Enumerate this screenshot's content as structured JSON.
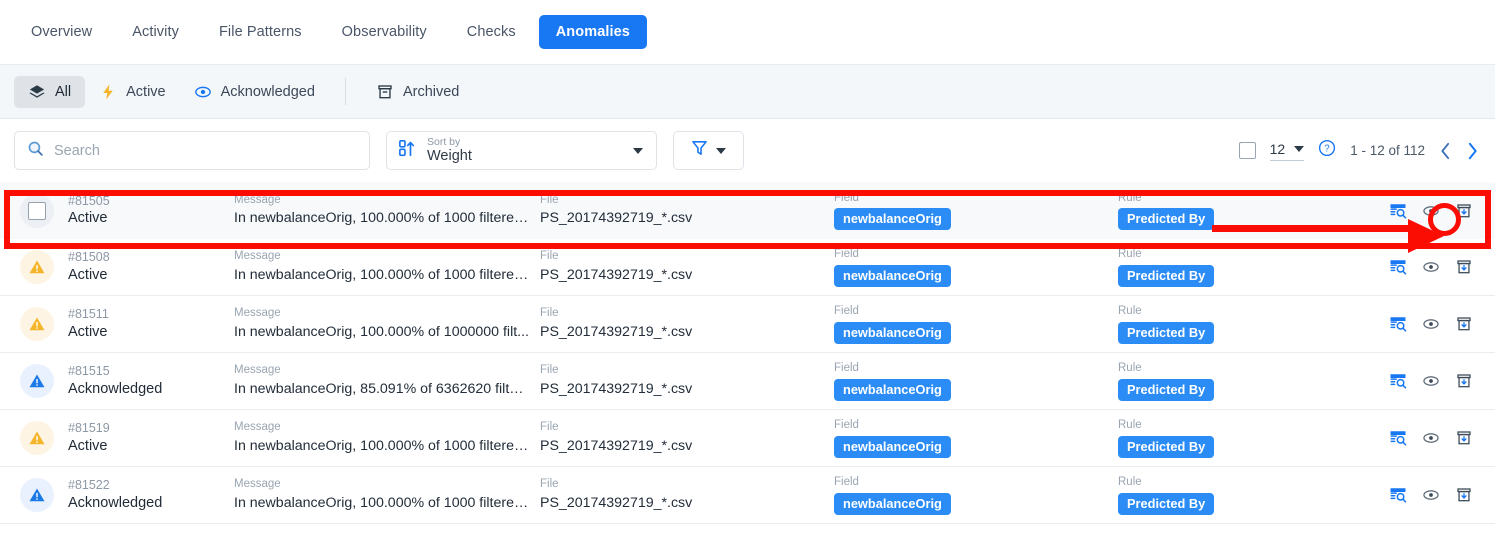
{
  "tabs": [
    {
      "label": "Overview",
      "active": false
    },
    {
      "label": "Activity",
      "active": false
    },
    {
      "label": "File Patterns",
      "active": false
    },
    {
      "label": "Observability",
      "active": false
    },
    {
      "label": "Checks",
      "active": false
    },
    {
      "label": "Anomalies",
      "active": true
    }
  ],
  "status_filters": [
    {
      "label": "All",
      "icon": "layers-icon",
      "selected": true
    },
    {
      "label": "Active",
      "icon": "lightning-bolt-icon",
      "selected": false
    },
    {
      "label": "Acknowledged",
      "icon": "eye-icon",
      "selected": false
    },
    {
      "label": "Archived",
      "icon": "archive-icon",
      "selected": false
    }
  ],
  "search": {
    "placeholder": "Search",
    "value": "",
    "icon": "search-icon"
  },
  "sort": {
    "caption": "Sort by",
    "value": "Weight",
    "icon": "sort-numeric-ascending-icon"
  },
  "filter_button": {
    "icon": "funnel-icon"
  },
  "pagination": {
    "select_all_checkbox": "unchecked",
    "page_size": "12",
    "help_icon": "question-mark-icon",
    "range": "1 - 12 of 112",
    "prev_icon": "chevron-left-icon",
    "next_icon": "chevron-right-icon"
  },
  "column_labels": {
    "message": "Message",
    "file": "File",
    "field": "Field",
    "rule": "Rule"
  },
  "row_actions": [
    {
      "name": "inspect-data-icon"
    },
    {
      "name": "acknowledge-eye-icon"
    },
    {
      "name": "archive-icon"
    }
  ],
  "rows": [
    {
      "id": "#81505",
      "state": "Active",
      "state_kind": "checkbox",
      "message": "In newbalanceOrig, 100.000% of 1000 filtered ...",
      "file": "PS_20174392719_*.csv",
      "field": "newbalanceOrig",
      "rule": "Predicted By",
      "highlighted": true
    },
    {
      "id": "#81508",
      "state": "Active",
      "state_kind": "active",
      "message": "In newbalanceOrig, 100.000% of 1000 filtered ...",
      "file": "PS_20174392719_*.csv",
      "field": "newbalanceOrig",
      "rule": "Predicted By",
      "highlighted": false
    },
    {
      "id": "#81511",
      "state": "Active",
      "state_kind": "active",
      "message": "In newbalanceOrig, 100.000% of 1000000 filt...",
      "file": "PS_20174392719_*.csv",
      "field": "newbalanceOrig",
      "rule": "Predicted By",
      "highlighted": false
    },
    {
      "id": "#81515",
      "state": "Acknowledged",
      "state_kind": "acknowledged",
      "message": "In newbalanceOrig, 85.091% of 6362620 filter...",
      "file": "PS_20174392719_*.csv",
      "field": "newbalanceOrig",
      "rule": "Predicted By",
      "highlighted": false
    },
    {
      "id": "#81519",
      "state": "Active",
      "state_kind": "active",
      "message": "In newbalanceOrig, 100.000% of 1000 filtered ...",
      "file": "PS_20174392719_*.csv",
      "field": "newbalanceOrig",
      "rule": "Predicted By",
      "highlighted": false
    },
    {
      "id": "#81522",
      "state": "Acknowledged",
      "state_kind": "acknowledged",
      "message": "In newbalanceOrig, 100.000% of 1000 filtered ...",
      "file": "PS_20174392719_*.csv",
      "field": "newbalanceOrig",
      "rule": "Predicted By",
      "highlighted": false
    }
  ],
  "colors": {
    "accent_blue": "#1877f2",
    "badge_blue": "#2b8cf5",
    "active_amber": "#f5b52a",
    "acknowledged_blue": "#1b7ae8",
    "annotation_red": "#fb0d04"
  }
}
